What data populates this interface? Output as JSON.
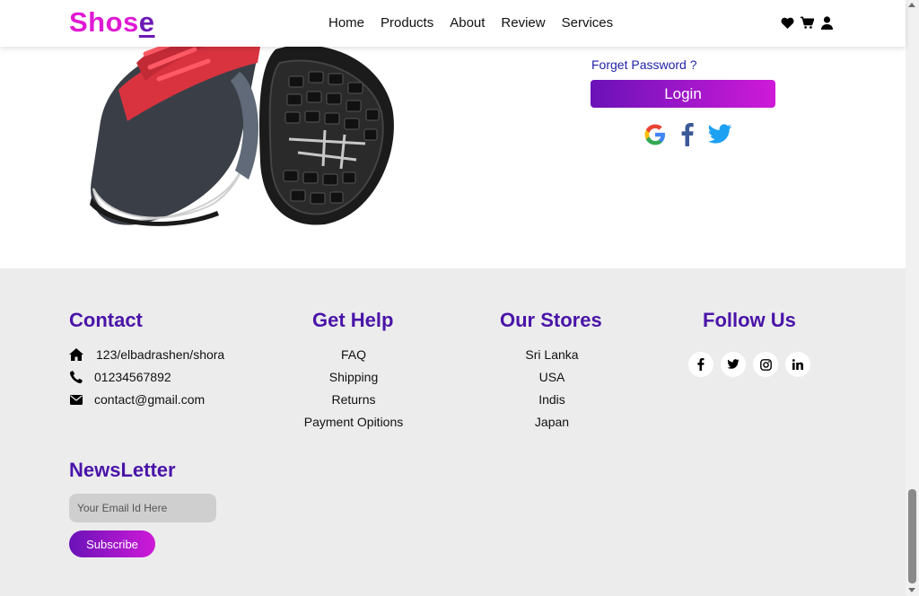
{
  "header": {
    "logo_main": "Shos",
    "logo_accent": "e",
    "nav": [
      "Home",
      "Products",
      "About",
      "Review",
      "Services"
    ],
    "icons": [
      "heart-icon",
      "cart-icon",
      "user-icon"
    ]
  },
  "login": {
    "forget_password": "Forget Password ?",
    "login_button": "Login",
    "social": [
      "google-icon",
      "facebook-icon",
      "twitter-icon"
    ]
  },
  "footer": {
    "contact": {
      "title": "Contact",
      "address": "123/elbadrashen/shora",
      "phone": "01234567892",
      "email": "contact@gmail.com"
    },
    "get_help": {
      "title": "Get Help",
      "links": [
        "FAQ",
        "Shipping",
        "Returns",
        "Payment Opitions"
      ]
    },
    "stores": {
      "title": "Our Stores",
      "links": [
        "Sri Lanka",
        "USA",
        "Indis",
        "Japan"
      ]
    },
    "follow": {
      "title": "Follow Us",
      "icons": [
        "facebook-icon",
        "twitter-icon",
        "instagram-icon",
        "linkedin-icon"
      ]
    },
    "newsletter": {
      "title": "NewsLetter",
      "placeholder": "Your Email Id Here",
      "button": "Subscribe"
    }
  },
  "colors": {
    "accent_purple": "#4a14a8",
    "logo_pink": "#e01ad4",
    "gradient_start": "#6a12b8",
    "gradient_end": "#cf1ad8",
    "footer_bg": "#ececec"
  }
}
